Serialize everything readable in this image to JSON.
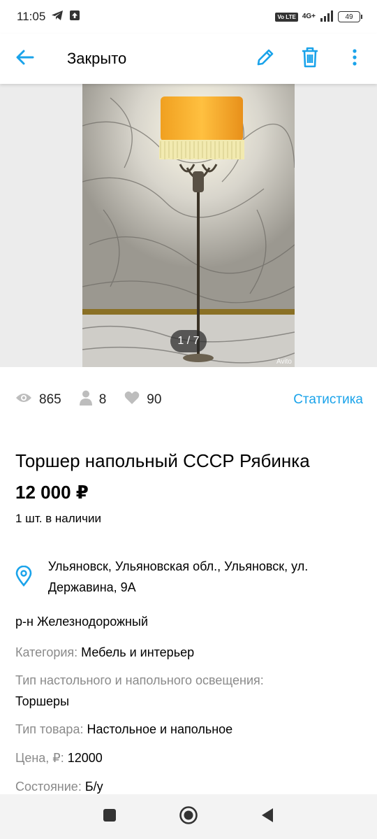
{
  "status_bar": {
    "time": "11:05",
    "volte": "Vo LTE",
    "network": "4G+",
    "battery": "49"
  },
  "app_bar": {
    "title": "Закрыто",
    "back_icon": "arrow-left-icon",
    "edit_icon": "pencil-icon",
    "delete_icon": "trash-icon",
    "menu_icon": "more-vert-icon"
  },
  "gallery": {
    "counter": "1 / 7",
    "watermark": "Avito"
  },
  "stats": {
    "views": "865",
    "contacts": "8",
    "favorites": "90",
    "link": "Статистика"
  },
  "listing": {
    "title": "Торшер напольный СССР Рябинка",
    "price": "12 000 ₽",
    "stock": "1 шт. в наличии",
    "address": "Ульяновск, Ульяновская обл., Ульяновск, ул. Державина, 9А",
    "district": "р-н Железнодорожный"
  },
  "params": [
    {
      "label": "Категория:",
      "value": "Мебель и интерьер"
    },
    {
      "label": "Тип настольного и напольного освещения:",
      "value": "Торшеры"
    },
    {
      "label": "Тип товара:",
      "value": "Настольное и напольное"
    },
    {
      "label": "Цена, ₽:",
      "value": "12000"
    },
    {
      "label": "Состояние:",
      "value": "Б/у"
    }
  ],
  "colors": {
    "accent": "#1aa3ea",
    "label_gray": "#8a8a8a"
  }
}
